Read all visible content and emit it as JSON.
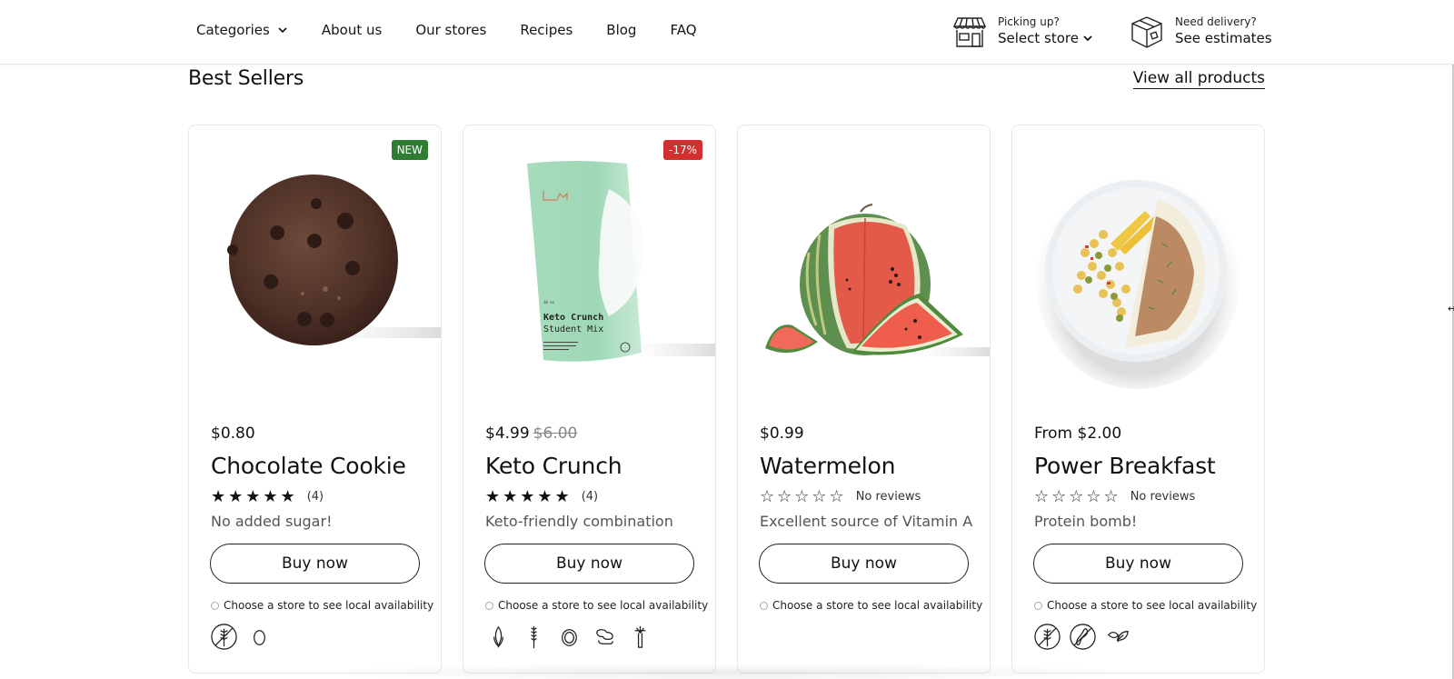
{
  "header": {
    "nav": [
      {
        "label": "Categories",
        "has_dropdown": true
      },
      {
        "label": "About us"
      },
      {
        "label": "Our stores"
      },
      {
        "label": "Recipes"
      },
      {
        "label": "Blog"
      },
      {
        "label": "FAQ"
      }
    ],
    "pickup": {
      "icon": "storefront-icon",
      "small": "Picking up?",
      "big": "Select store"
    },
    "delivery": {
      "icon": "package-box-icon",
      "small": "Need delivery?",
      "big": "See estimates"
    }
  },
  "section": {
    "title": "Best Sellers",
    "view_all": "View all products"
  },
  "colors": {
    "badge_new": "#2e7d32",
    "badge_sale": "#d32f2f",
    "text": "#111111",
    "muted": "#555555"
  },
  "products": [
    {
      "name": "Chocolate Cookie",
      "price": "$0.80",
      "old_price": "",
      "badge": "NEW",
      "badge_type": "new",
      "rating": 5,
      "rating_text": "(4)",
      "description": "No added sugar!",
      "button": "Buy now",
      "availability": "Choose a store to see local availability",
      "image": "chocolate-cookie-image",
      "diet_icons": [
        "gluten-free-icon",
        "egg-icon"
      ]
    },
    {
      "name": "Keto Crunch",
      "price": "$4.99",
      "old_price": "$6.00",
      "badge": "-17%",
      "badge_type": "sale",
      "rating": 5,
      "rating_text": "(4)",
      "description": "Keto-friendly combination",
      "button": "Buy now",
      "availability": "Choose a store to see local availability",
      "image": "keto-crunch-bag-image",
      "package_text": {
        "weight": "10 oz",
        "line1": "Keto Crunch",
        "line2": "Student Mix"
      },
      "diet_icons": [
        "corn-icon",
        "wheat-icon",
        "nut-icon",
        "peanut-icon",
        "celery-icon"
      ]
    },
    {
      "name": "Watermelon",
      "price": "$0.99",
      "old_price": "",
      "badge": "",
      "badge_type": "",
      "rating": 0,
      "rating_text": "No reviews",
      "description": "Excellent source of Vitamin A",
      "button": "Buy now",
      "availability": "Choose a store to see local availability",
      "image": "watermelon-image",
      "diet_icons": []
    },
    {
      "name": "Power Breakfast",
      "price": "From $2.00",
      "old_price": "",
      "badge": "",
      "badge_type": "",
      "rating": 0,
      "rating_text": "No reviews",
      "description": "Protein bomb!",
      "button": "Buy now",
      "availability": "Choose a store to see local availability",
      "image": "power-breakfast-plate-image",
      "diet_icons": [
        "gluten-free-icon",
        "peanut-free-icon",
        "vegan-leaf-icon"
      ]
    }
  ]
}
